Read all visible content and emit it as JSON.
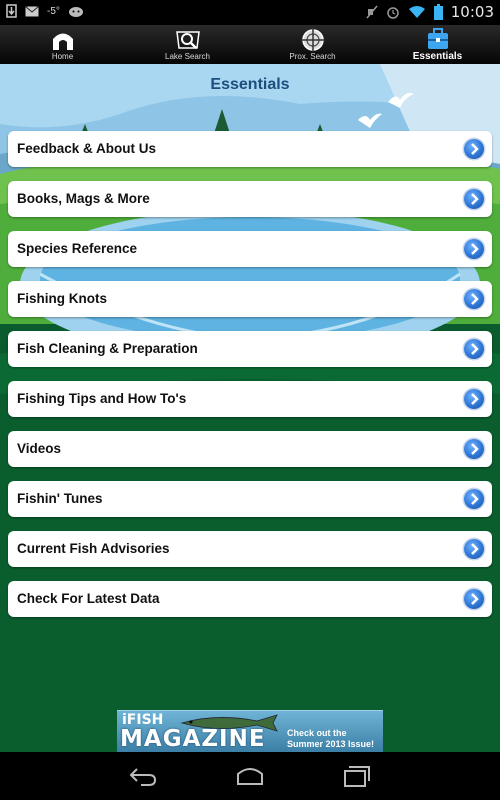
{
  "status_bar": {
    "temperature": "-5°",
    "time": "10:03",
    "icons": [
      "download-icon",
      "mail-icon",
      "android-icon",
      "mute-icon",
      "alarm-icon",
      "wifi-icon",
      "battery-icon"
    ]
  },
  "tabs": [
    {
      "label": "Home",
      "icon": "home-icon",
      "active": false
    },
    {
      "label": "Lake Search",
      "icon": "map-search-icon",
      "active": false
    },
    {
      "label": "Prox. Search",
      "icon": "crosshair-icon",
      "active": false
    },
    {
      "label": "Essentials",
      "icon": "tackle-box-icon",
      "active": true
    }
  ],
  "page": {
    "title": "Essentials"
  },
  "menu": [
    {
      "label": "Feedback & About Us"
    },
    {
      "label": "Books, Mags & More"
    },
    {
      "label": "Species Reference"
    },
    {
      "label": "Fishing Knots"
    },
    {
      "label": "Fish Cleaning & Preparation"
    },
    {
      "label": "Fishing Tips and How To's"
    },
    {
      "label": "Videos"
    },
    {
      "label": "Fishin' Tunes"
    },
    {
      "label": "Current Fish Advisories"
    },
    {
      "label": "Check For Latest Data"
    }
  ],
  "ad": {
    "brand_small": "iFISH",
    "brand_big": "MAGAZINE",
    "promo_line1": "Check out the",
    "promo_line2": "Summer 2013 Issue!"
  },
  "nav_bar": {
    "buttons": [
      "back-icon",
      "home-icon",
      "recents-icon"
    ]
  },
  "colors": {
    "title": "#1c4f7e",
    "chevron": "#2d76d6",
    "background": "#0b5d2f"
  }
}
